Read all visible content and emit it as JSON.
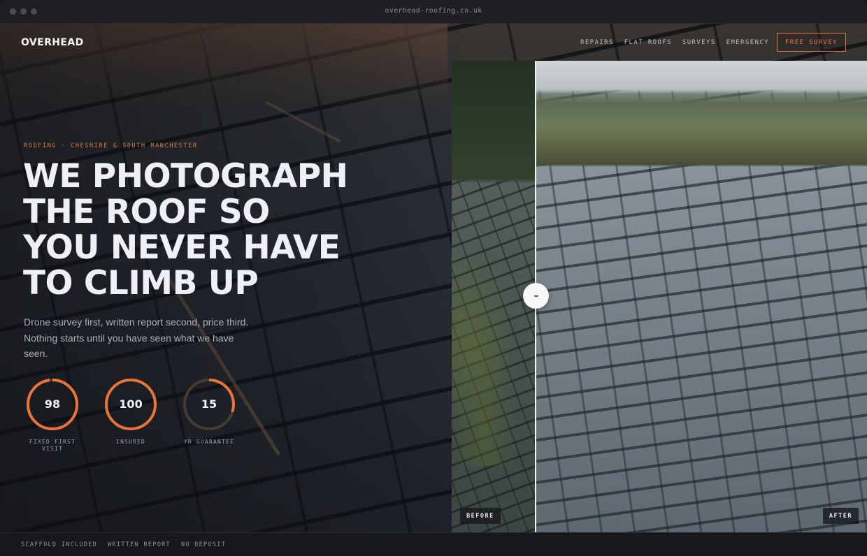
{
  "browser": {
    "url": "overhead-roofing.co.uk"
  },
  "header": {
    "logo": "OVERHEAD",
    "nav": [
      "REPAIRS",
      "FLAT ROOFS",
      "SURVEYS",
      "EMERGENCY"
    ],
    "cta_label": "FREE SURVEY"
  },
  "hero": {
    "eyebrow": "ROOFING · CHESHIRE & SOUTH MANCHESTER",
    "headline_lines": [
      "WE PHOTOGRAPH",
      "THE ROOF SO",
      "YOU NEVER HAVE",
      "TO CLIMB UP"
    ],
    "subcopy": "Drone survey first, written report second, price third. Nothing starts until you have seen what we have seen.",
    "stats": [
      {
        "value": "98",
        "label": "FIXED FIRST VISIT",
        "fill": 0.98
      },
      {
        "value": "100",
        "label": "INSURED",
        "fill": 1.0
      },
      {
        "value": "15",
        "label": "YR GUARANTEE",
        "fill": 0.3
      }
    ]
  },
  "compare": {
    "handle_glyph": "◂▸",
    "before_label": "BEFORE",
    "after_label": "AFTER",
    "split_position": 0.2
  },
  "footer": {
    "features": [
      "SCAFFOLD INCLUDED",
      "WRITTEN REPORT",
      "NO DEPOSIT"
    ]
  },
  "colors": {
    "accent": "#e8743a",
    "ring_track": "#4a3a32"
  }
}
